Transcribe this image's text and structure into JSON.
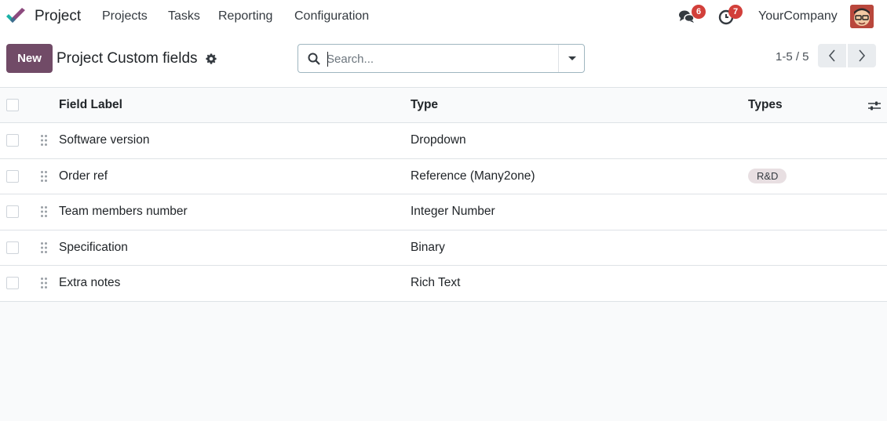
{
  "navbar": {
    "app_name": "Project",
    "menu": [
      "Projects",
      "Tasks",
      "Reporting",
      "Configuration"
    ],
    "messages_count": "6",
    "activities_count": "7",
    "company": "YourCompany",
    "logo_icon": "odoo-project-check-icon",
    "messages_icon": "chat-bubbles-icon",
    "activities_icon": "clock-icon",
    "accent_color": "#714b67",
    "badge_color": "#d23f3a"
  },
  "control": {
    "new_label": "New",
    "title": "Project Custom fields",
    "search_placeholder": "Search...",
    "pager": "1-5 / 5"
  },
  "list": {
    "columns": [
      "Field Label",
      "Type",
      "Types"
    ],
    "rows": [
      {
        "label": "Software version",
        "type": "Dropdown",
        "types": ""
      },
      {
        "label": "Order ref",
        "type": "Reference (Many2one)",
        "types": "R&D"
      },
      {
        "label": "Team members number",
        "type": "Integer Number",
        "types": ""
      },
      {
        "label": "Specification",
        "type": "Binary",
        "types": ""
      },
      {
        "label": "Extra notes",
        "type": "Rich Text",
        "types": ""
      }
    ]
  }
}
